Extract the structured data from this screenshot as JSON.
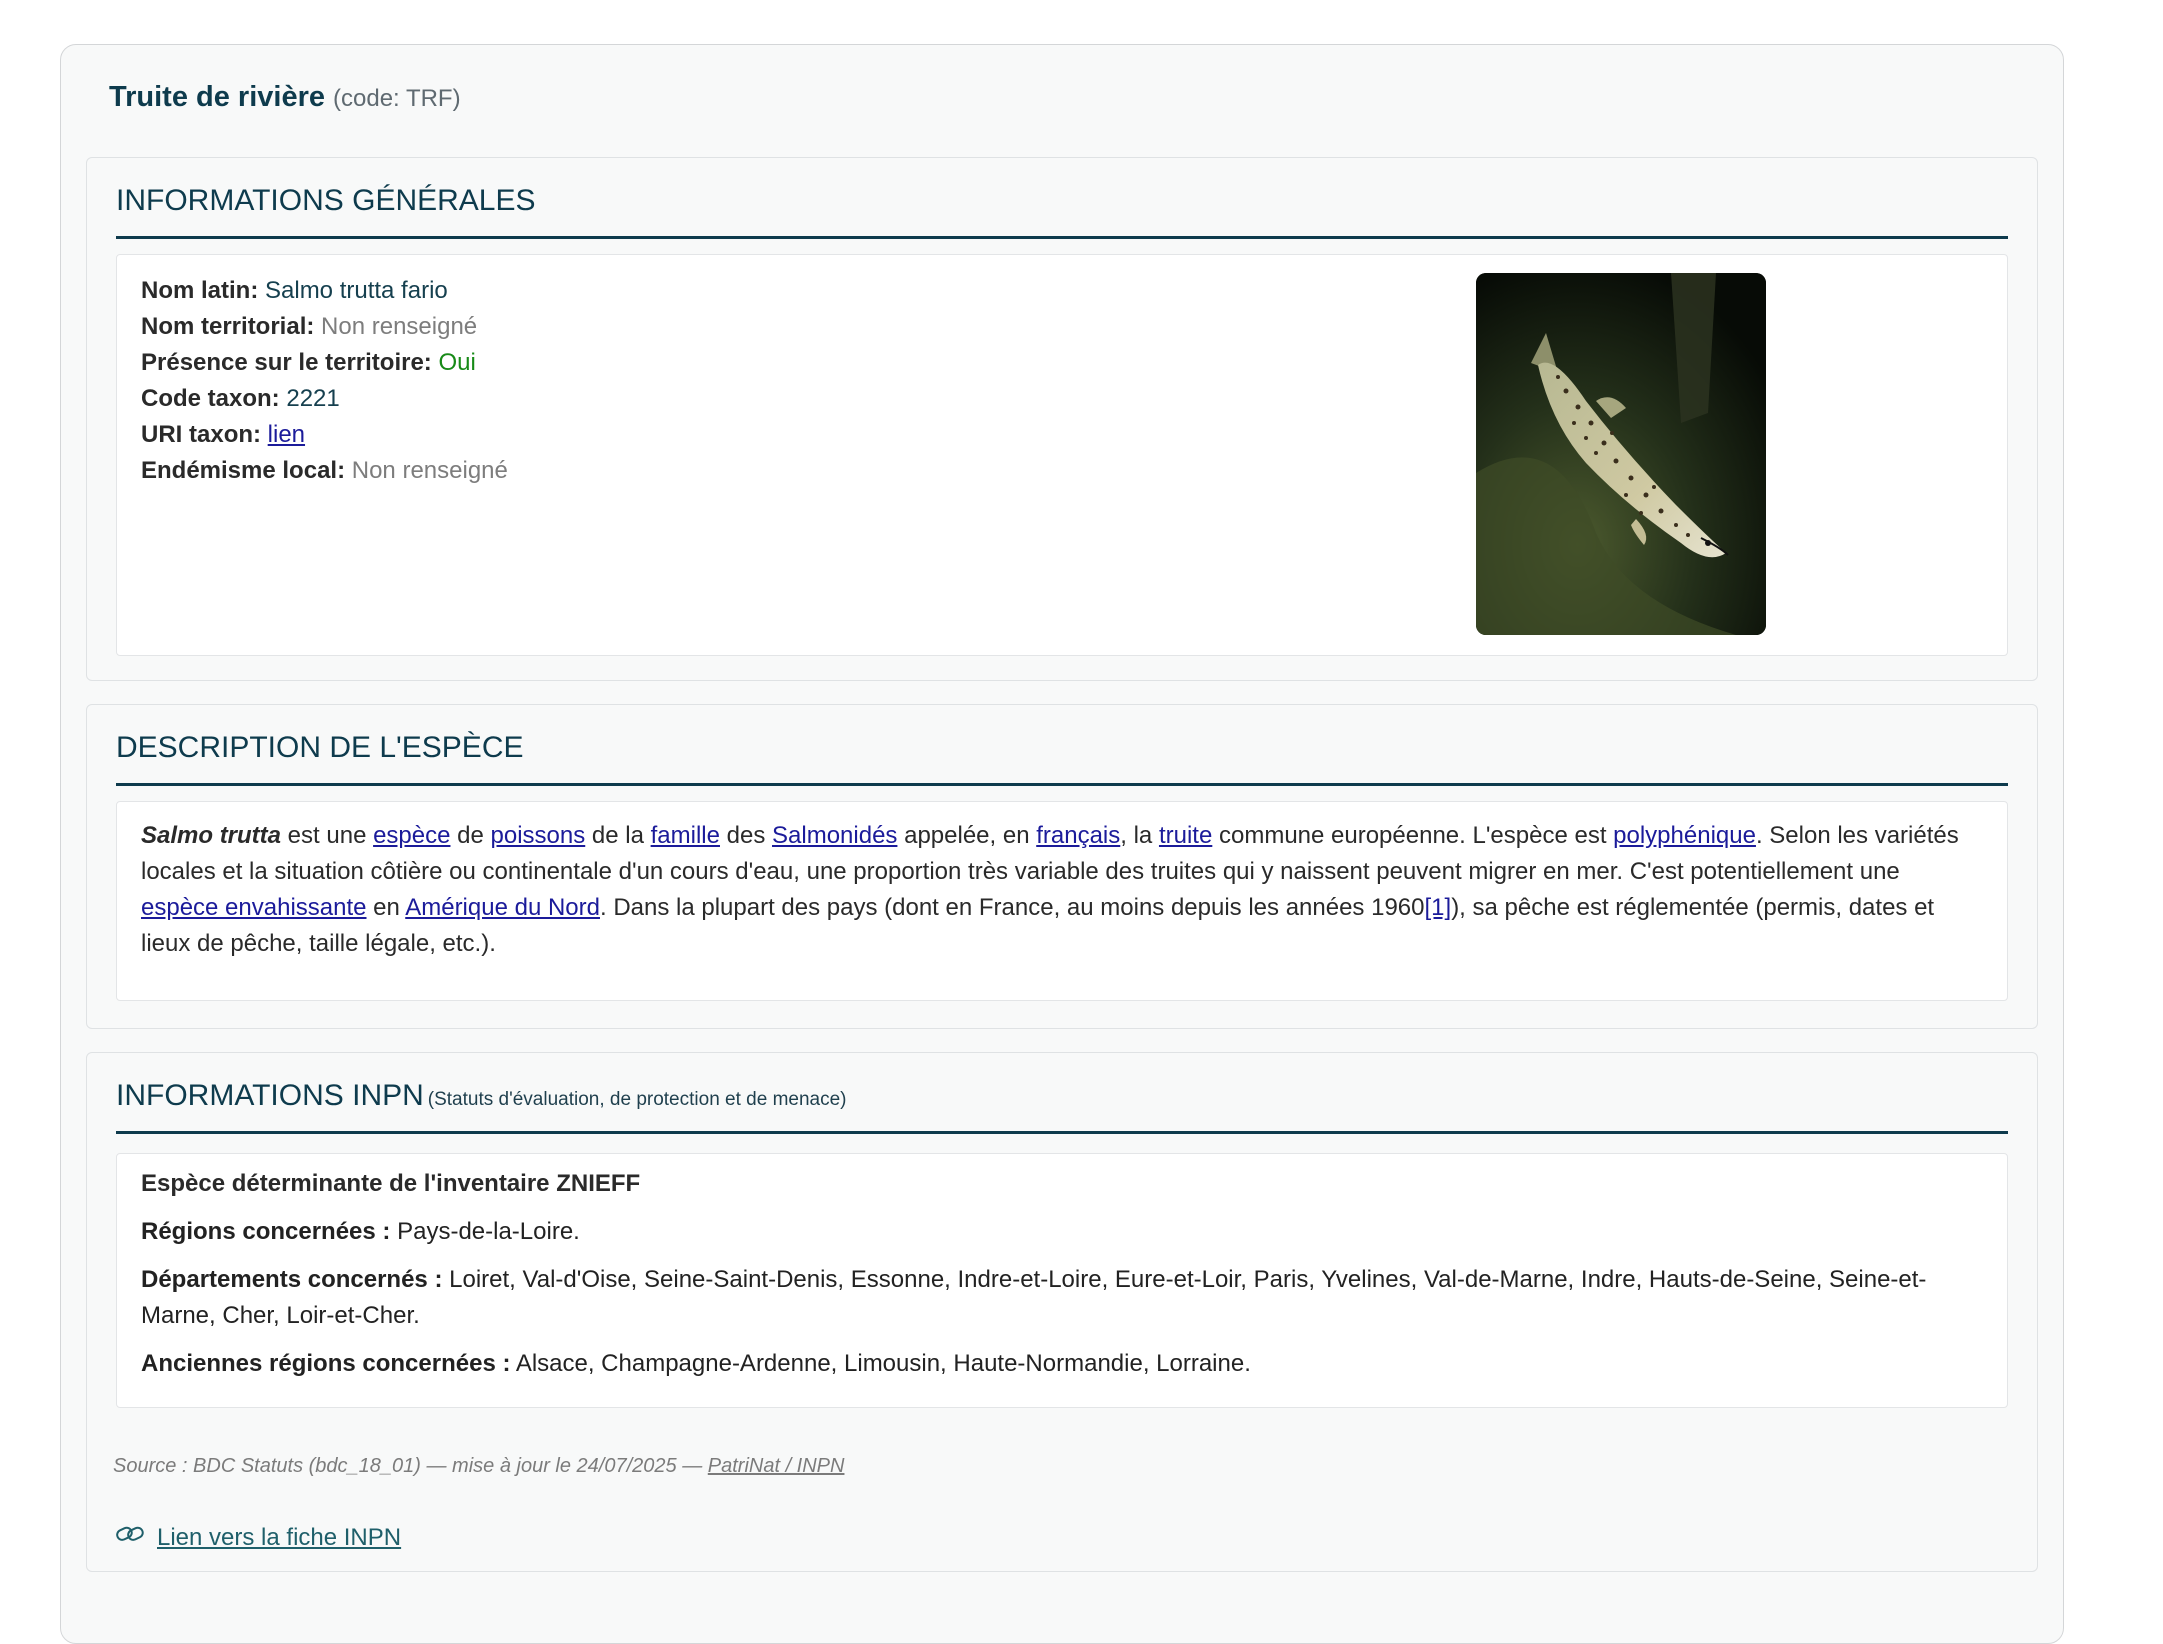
{
  "species": {
    "name": "Truite de rivière",
    "code": "(code: TRF)"
  },
  "general": {
    "title": "INFORMATIONS GÉNÉRALES",
    "latin_label": "Nom latin:",
    "latin_value": "Salmo trutta fario",
    "territorial_label": "Nom territorial:",
    "territorial_value": "Non renseigné",
    "presence_label": "Présence sur le territoire:",
    "presence_value": "Oui",
    "taxon_code_label": "Code taxon:",
    "taxon_code_value": "2221",
    "uri_label": "URI taxon:",
    "uri_link": "lien",
    "endemism_label": "Endémisme local:",
    "endemism_value": "Non renseigné"
  },
  "description": {
    "title": "DESCRIPTION DE L'ESPÈCE",
    "p": {
      "s0": "Salmo trutta",
      "t1": " est une ",
      "l1": "espèce",
      "t2": " de ",
      "l2": "poissons",
      "t3": " de la ",
      "l3": "famille",
      "t4": " des ",
      "l4": "Salmonidés",
      "t5": " appelée, en ",
      "l5": "français",
      "t6": ", la ",
      "l6": "truite",
      "t7": " commune européenne. L'espèce est ",
      "l7": "polyphénique",
      "t8": ". Selon les variétés locales et la situation côtière ou continentale d'un cours d'eau, une proportion très variable des truites qui y naissent peuvent migrer en mer. C'est potentiellement une ",
      "l8": "espèce envahissante",
      "t9": " en ",
      "l9": "Amérique du Nord",
      "t10": ". Dans la plupart des pays (dont en France, au moins depuis les années 1960",
      "l10": "[1]",
      "t11": "), sa pêche est réglementée (permis, dates et lieux de pêche, taille légale, etc.)."
    }
  },
  "inpn": {
    "title": "INFORMATIONS INPN",
    "subtitle": "(Statuts d'évaluation, de protection et de menace)",
    "heading": "Espèce déterminante de l'inventaire ZNIEFF",
    "regions_label": "Régions concernées :",
    "regions_value": " Pays-de-la-Loire.",
    "departments_label": "Départements concernés :",
    "departments_value": " Loiret, Val-d'Oise, Seine-Saint-Denis, Essonne, Indre-et-Loire, Eure-et-Loir, Paris, Yvelines, Val-de-Marne, Indre, Hauts-de-Seine, Seine-et-Marne, Cher, Loir-et-Cher.",
    "old_regions_label": "Anciennes régions concernées :",
    "old_regions_value": " Alsace, Champagne-Ardenne, Limousin, Haute-Normandie, Lorraine.",
    "source_text": "Source : BDC Statuts (bdc_18_01) — mise à jour le 24/07/2025 — ",
    "source_link": "PatriNat / INPN",
    "fiche_link": "Lien vers la fiche INPN"
  }
}
